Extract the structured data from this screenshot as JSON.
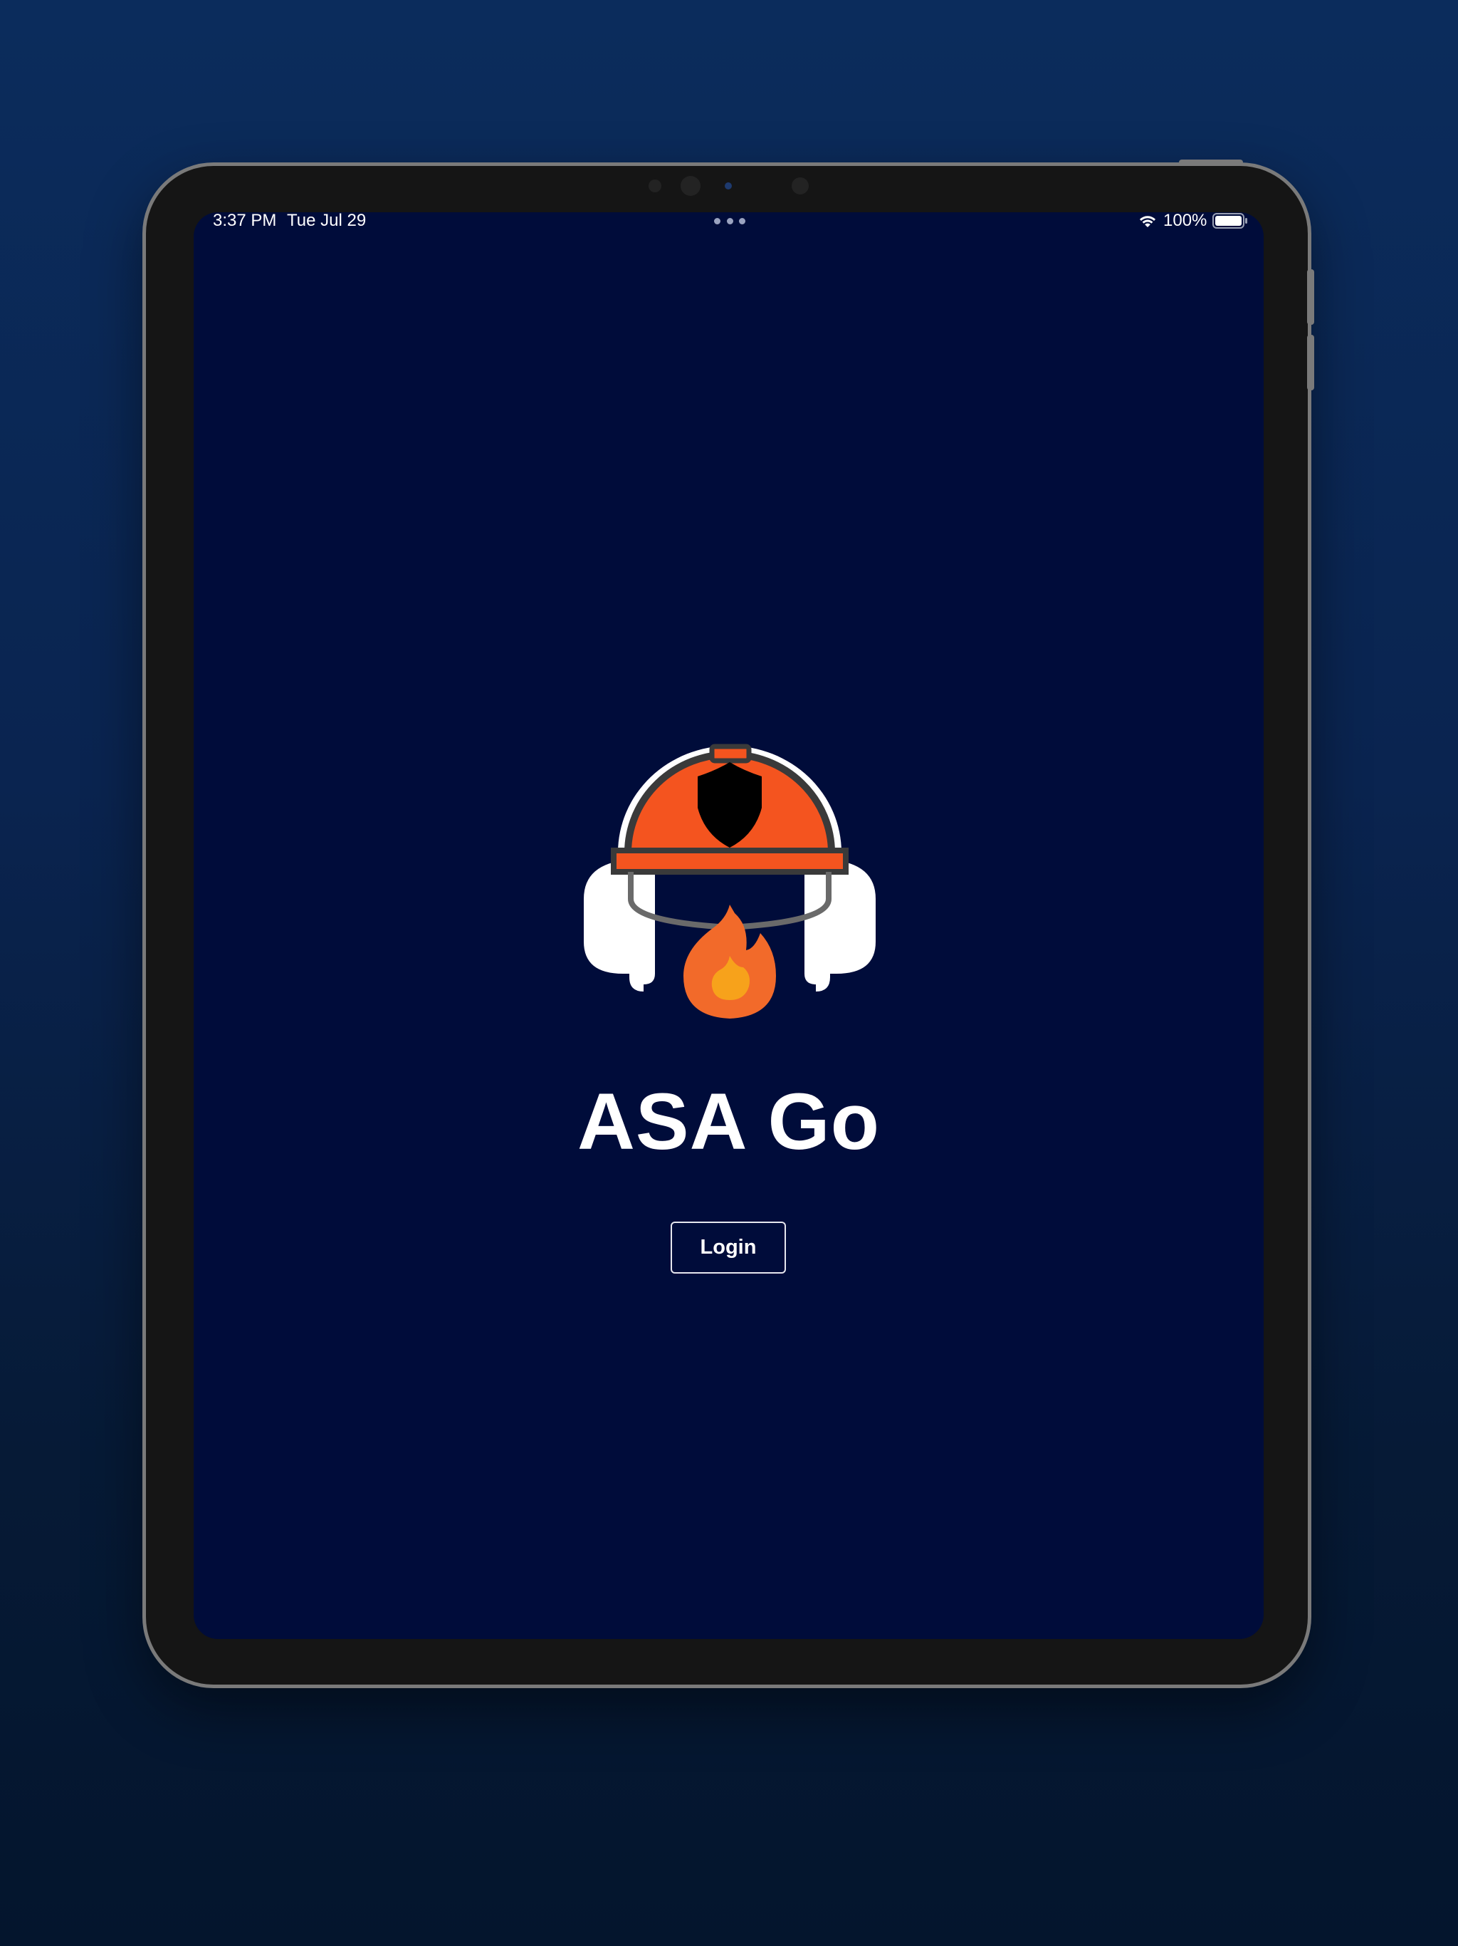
{
  "status_bar": {
    "time": "3:37 PM",
    "date": "Tue Jul 29",
    "battery_percent": "100%",
    "battery_level": 1.0,
    "icons": [
      "wifi-icon",
      "battery-icon",
      "multitasking-dots-icon"
    ]
  },
  "app": {
    "title": "ASA Go",
    "login_label": "Login",
    "logo": "firefighter-helmet-flame-logo"
  },
  "colors": {
    "screen_background": "#000c3a",
    "helmet_orange": "#f4541f",
    "flame_orange": "#f26a2a",
    "flame_core": "#f7a21b",
    "outline_dark": "#3a3a3a",
    "white": "#ffffff"
  }
}
